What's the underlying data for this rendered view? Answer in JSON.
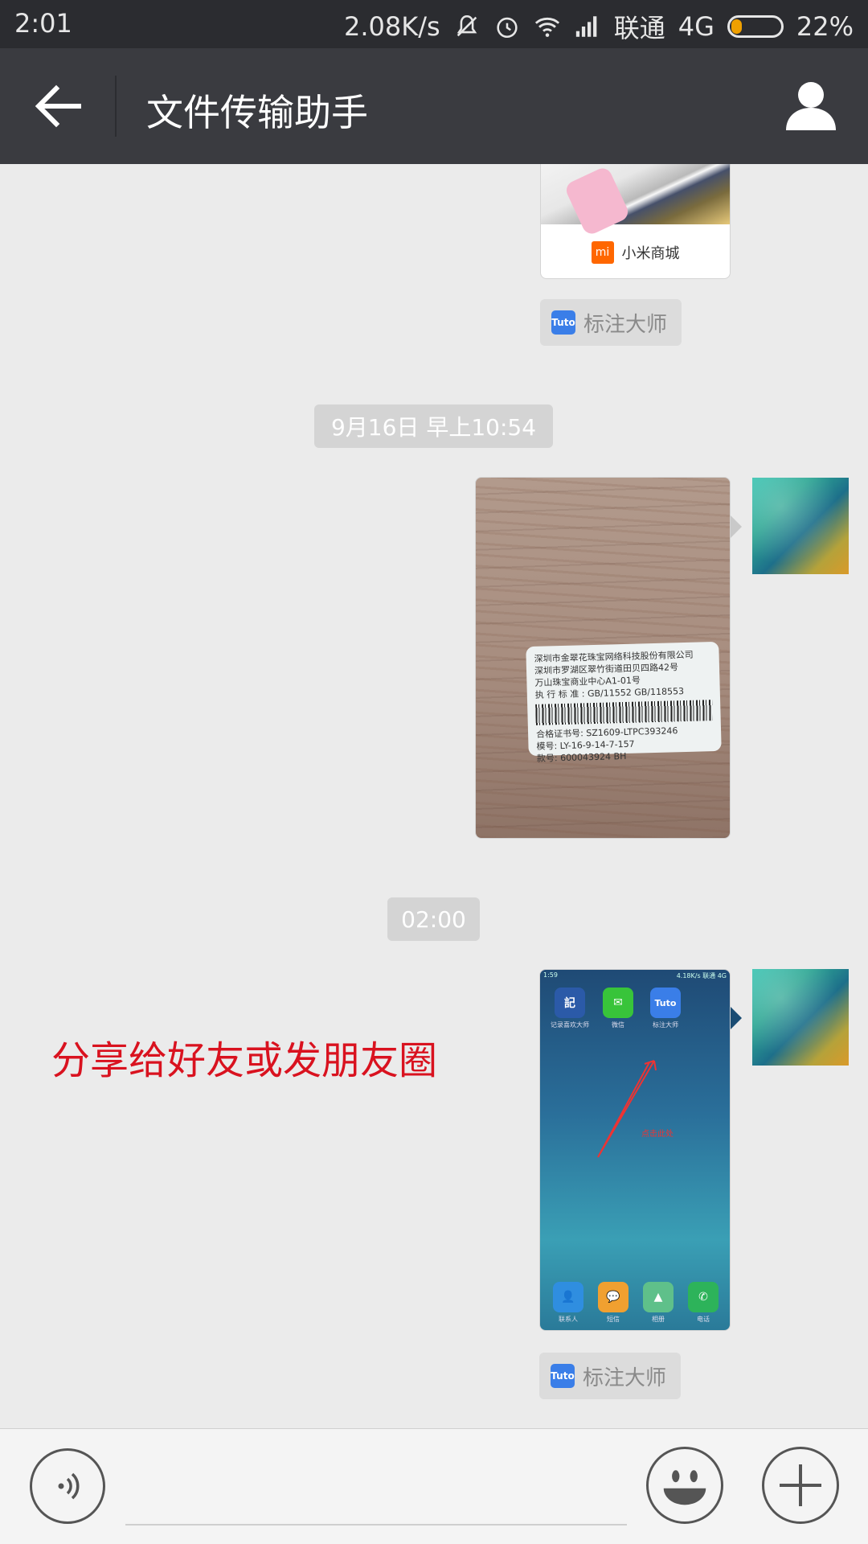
{
  "status_bar": {
    "time": "2:01",
    "net_speed": "2.08K/s",
    "carrier": "联通",
    "network": "4G",
    "battery_pct": "22%",
    "battery_level": 0.22
  },
  "title_bar": {
    "title": "文件传输助手"
  },
  "chat": {
    "mi_card_brand": "小米商城",
    "mi_logo": "mi",
    "source_tag_1": "标注大师",
    "timestamp_1": "9月16日 早上10:54",
    "label_lines": [
      "深圳市金翠花珠宝网络科技股份有限公司",
      "深圳市罗湖区翠竹街道田贝四路42号",
      "万山珠宝商业中心A1-01号",
      "执 行 标 准 : GB/11552 GB/118553",
      "合格证书号: SZ1609-LTPC393246",
      "模号: LY-16-9-14-7-157",
      "款号: 600043924   BH"
    ],
    "timestamp_2": "02:00",
    "annotation_text": "分享给好友或发朋友圈",
    "phone_screenshot": {
      "status_time": "1:59",
      "status_right": "4.18K/s 联通 4G",
      "apps_top": [
        {
          "icon": "記",
          "label": "记录喜欢大师",
          "color": "#2b5aa8"
        },
        {
          "icon": "✉",
          "label": "微信",
          "color": "#38c43a"
        },
        {
          "icon": "Tuto",
          "label": "标注大师",
          "color": "#3a7ee8"
        }
      ],
      "arrow_note": "点击此处",
      "dock_apps": [
        {
          "icon": "👤",
          "label": "联系人",
          "color": "#2f8ee0"
        },
        {
          "icon": "💬",
          "label": "短信",
          "color": "#f0a030"
        },
        {
          "icon": "▲",
          "label": "相册",
          "color": "#5fc08a"
        },
        {
          "icon": "✆",
          "label": "电话",
          "color": "#2db35a"
        }
      ]
    },
    "source_tag_2": "标注大师",
    "tuto_icon_text": "Tuto"
  }
}
